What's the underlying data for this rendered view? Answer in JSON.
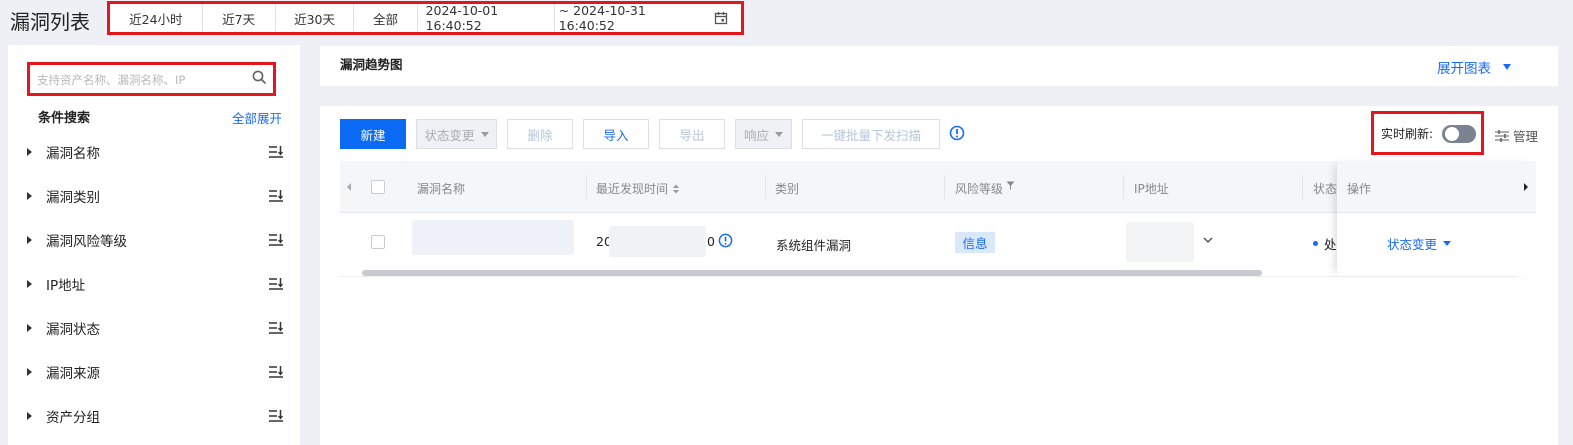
{
  "page_title": "漏洞列表",
  "time_range": {
    "options": [
      "近24小时",
      "近7天",
      "近30天",
      "全部"
    ],
    "start": "2024-10-01 16:40:52",
    "end": "~ 2024-10-31 16:40:52"
  },
  "sidebar": {
    "search_placeholder": "支持资产名称、漏洞名称、IP",
    "condition_title": "条件搜索",
    "expand_all": "全部展开",
    "filters": [
      "漏洞名称",
      "漏洞类别",
      "漏洞风险等级",
      "IP地址",
      "漏洞状态",
      "漏洞来源",
      "资产分组"
    ]
  },
  "trend": {
    "title": "漏洞趋势图",
    "expand_chart": "展开图表"
  },
  "toolbar": {
    "new": "新建",
    "status_change": "状态变更",
    "delete": "删除",
    "import": "导入",
    "export": "导出",
    "respond": "响应",
    "batch_scan": "一键批量下发扫描",
    "realtime_refresh": "实时刷新:",
    "manage": "管理"
  },
  "table": {
    "columns": {
      "name": "漏洞名称",
      "recent_time": "最近发现时间",
      "category": "类别",
      "risk": "风险等级",
      "ip": "IP地址",
      "status": "状态",
      "actions": "操作"
    },
    "rows": [
      {
        "time_prefix": "20",
        "time_suffix": "0",
        "category": "系统组件漏洞",
        "risk": "信息",
        "status": "处",
        "action": "状态变更"
      }
    ]
  },
  "colors": {
    "accent": "#0a6af4",
    "link": "#1a6bf3",
    "highlight_border": "#e3161e"
  }
}
